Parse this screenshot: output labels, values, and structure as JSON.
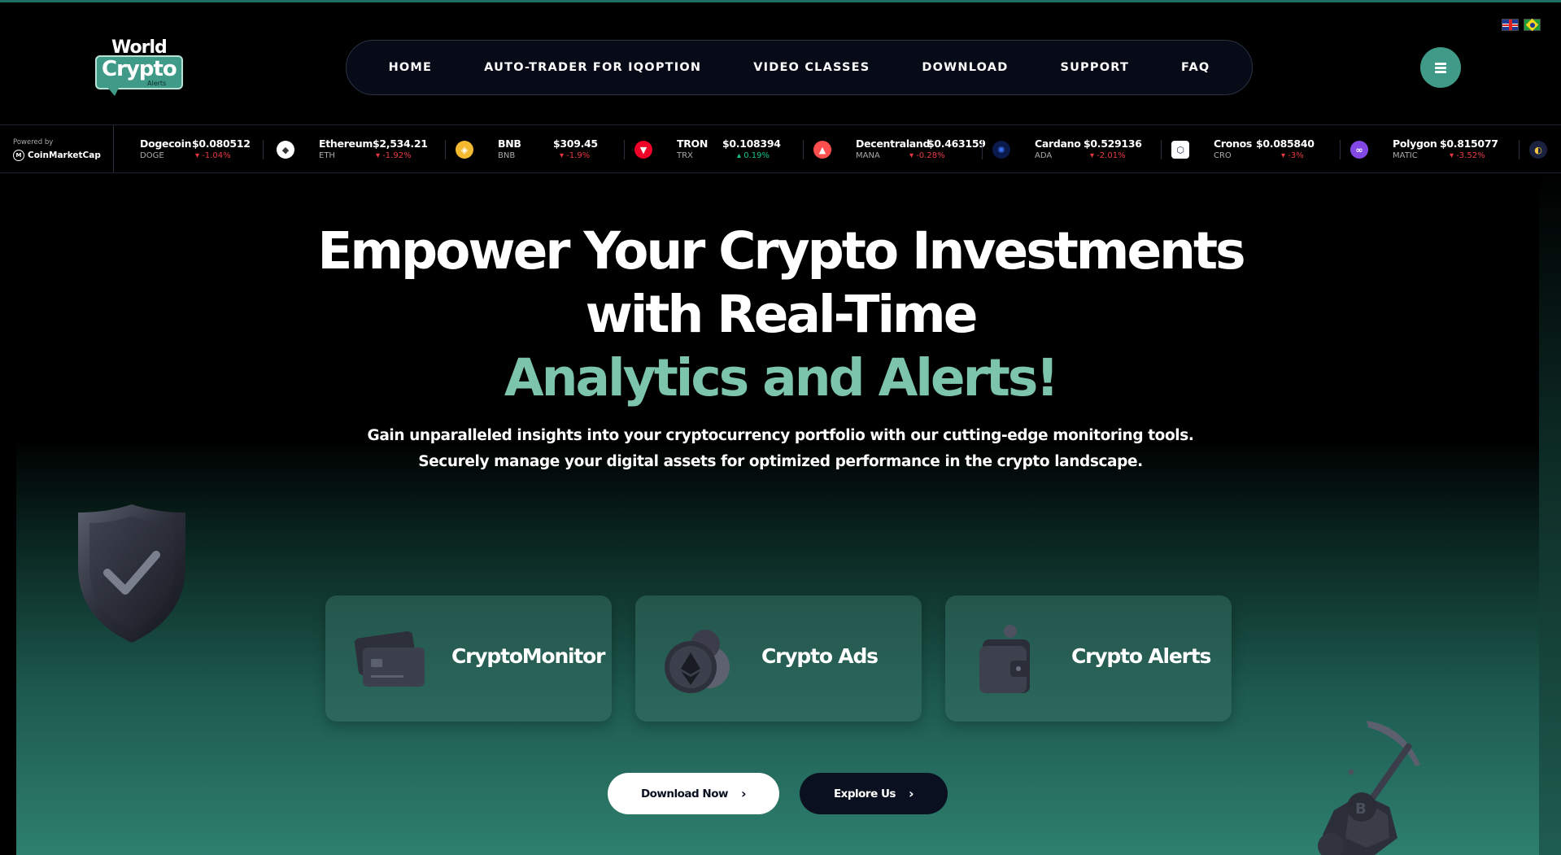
{
  "brand": {
    "world": "World",
    "crypto": "Crypto",
    "alerts": "Alerts"
  },
  "nav": {
    "items": [
      {
        "label": "HOME"
      },
      {
        "label": "AUTO-TRADER FOR IQOPTION"
      },
      {
        "label": "VIDEO CLASSES"
      },
      {
        "label": "DOWNLOAD"
      },
      {
        "label": "SUPPORT"
      },
      {
        "label": "FAQ"
      }
    ]
  },
  "languages": [
    "uk-flag-icon",
    "brazil-flag-icon"
  ],
  "ticker": {
    "powered_by": "Powered by",
    "provider": "CoinMarketCap",
    "coins": [
      {
        "name": "Dogecoin",
        "symbol": "DOGE",
        "price": "$0.080512",
        "change": "-1.04%",
        "direction": "down"
      },
      {
        "name": "Ethereum",
        "symbol": "ETH",
        "price": "$2,534.21",
        "change": "-1.92%",
        "direction": "down"
      },
      {
        "name": "BNB",
        "symbol": "BNB",
        "price": "$309.45",
        "change": "-1.9%",
        "direction": "down"
      },
      {
        "name": "TRON",
        "symbol": "TRX",
        "price": "$0.108394",
        "change": "0.19%",
        "direction": "up"
      },
      {
        "name": "Decentraland",
        "symbol": "MANA",
        "price": "$0.463159",
        "change": "-0.28%",
        "direction": "down"
      },
      {
        "name": "Cardano",
        "symbol": "ADA",
        "price": "$0.529136",
        "change": "-2.01%",
        "direction": "down"
      },
      {
        "name": "Cronos",
        "symbol": "CRO",
        "price": "$0.085840",
        "change": "-3%",
        "direction": "down"
      },
      {
        "name": "Polygon",
        "symbol": "MATIC",
        "price": "$0.815077",
        "change": "-3.52%",
        "direction": "down"
      }
    ]
  },
  "hero": {
    "line1": "Empower Your Crypto Investments",
    "line2": "with Real-Time",
    "line3": "Analytics and Alerts!",
    "sub1": "Gain unparalleled insights into your cryptocurrency portfolio with our cutting-edge monitoring tools.",
    "sub2": "Securely manage your digital assets for optimized performance in the crypto landscape."
  },
  "cards": [
    {
      "label": "CryptoMonitor"
    },
    {
      "label": "Crypto Ads"
    },
    {
      "label": "Crypto Alerts"
    }
  ],
  "buttons": {
    "download": "Download Now",
    "explore": "Explore Us"
  },
  "colors": {
    "accent": "#3f9a87",
    "accent_light": "#7cc4ac",
    "down": "#ea3943",
    "up": "#16c784",
    "nav_bg": "#070b18"
  }
}
